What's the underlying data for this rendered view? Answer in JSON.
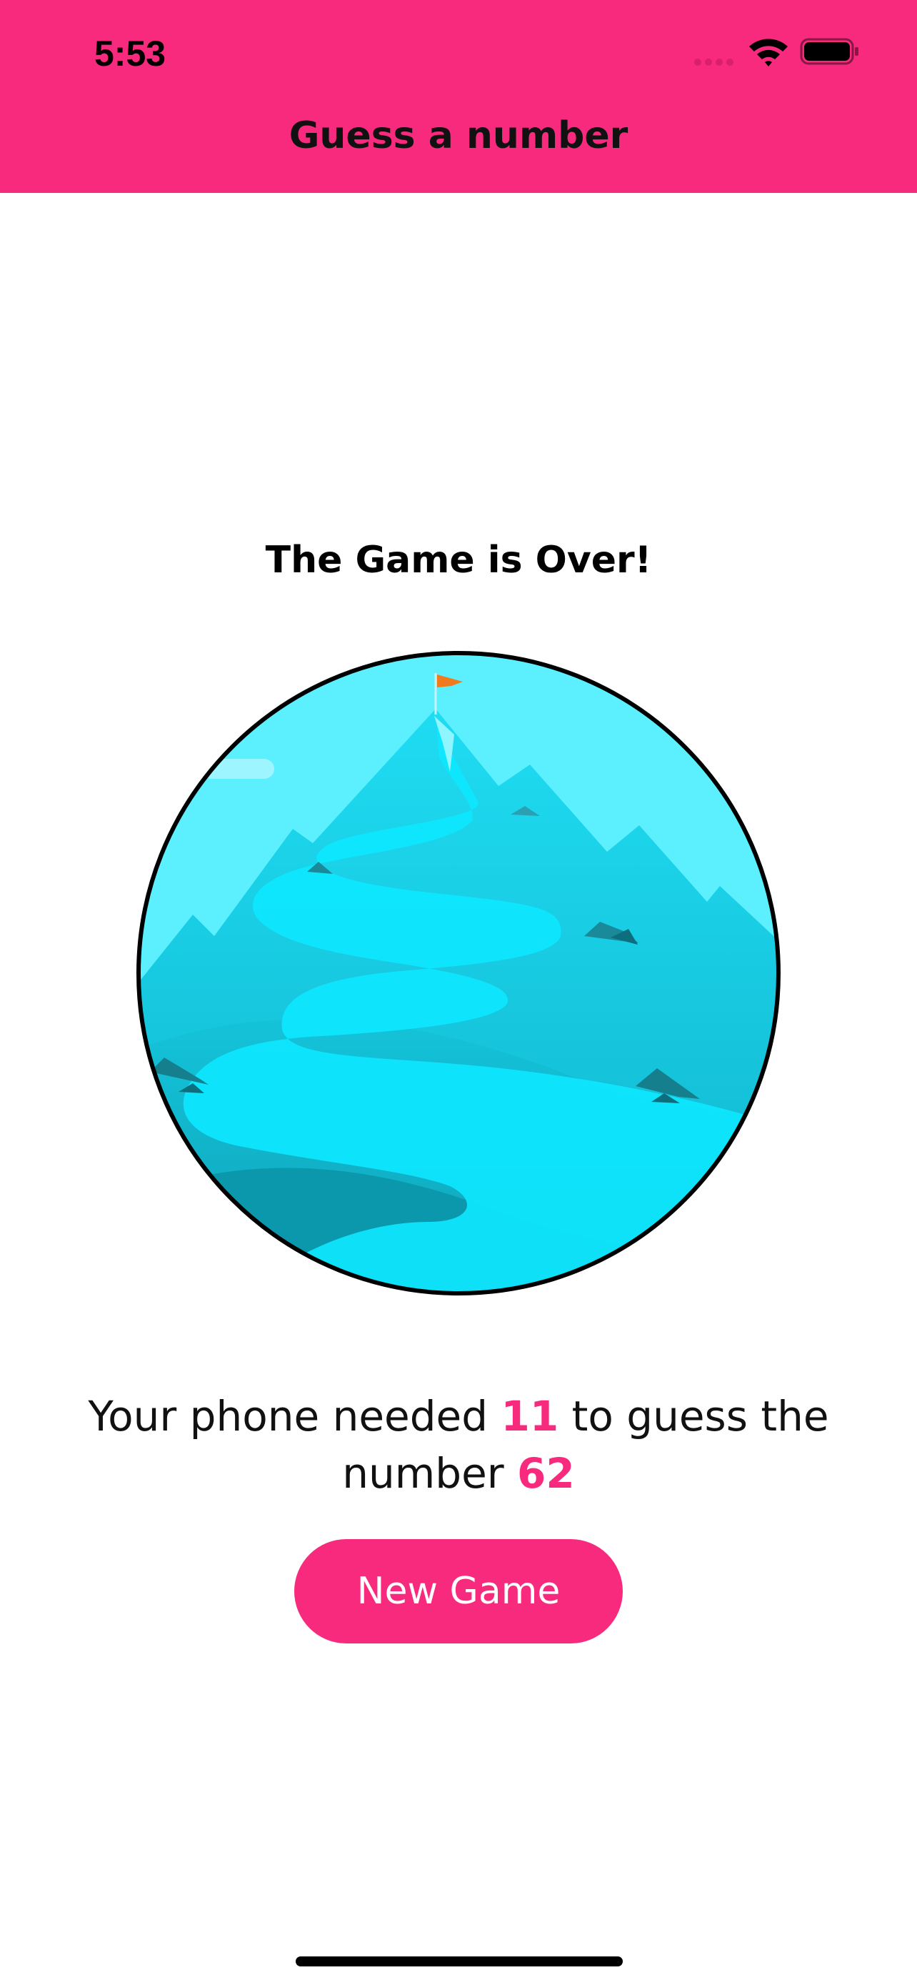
{
  "status_bar": {
    "time": "5:53"
  },
  "header": {
    "title": "Guess a number",
    "background_color": "#f72a7d"
  },
  "main": {
    "heading": "The Game is Over!",
    "summary": {
      "part1": "Your phone needed ",
      "rounds": "11",
      "part2": " to guess the number ",
      "number": "62"
    },
    "new_game_label": "New Game"
  },
  "colors": {
    "accent": "#f72a7d",
    "sky": "#5cf0ff",
    "text": "#111111"
  },
  "icons": [
    "wifi-icon",
    "battery-icon",
    "cellular-signal-icon",
    "mountain-summit-illustration",
    "flag-icon"
  ]
}
